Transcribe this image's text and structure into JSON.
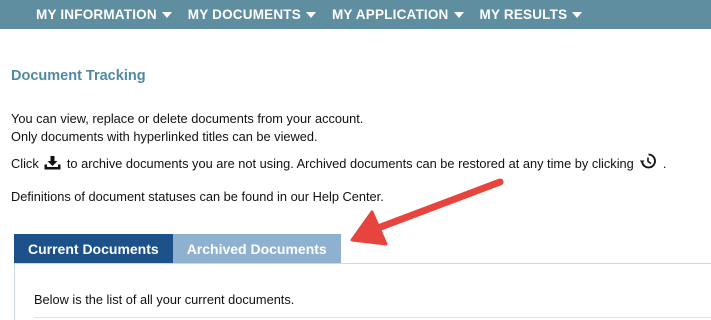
{
  "nav": {
    "items": [
      {
        "label": "MY INFORMATION"
      },
      {
        "label": "MY DOCUMENTS"
      },
      {
        "label": "MY APPLICATION"
      },
      {
        "label": "MY RESULTS"
      }
    ]
  },
  "page": {
    "title": "Document Tracking",
    "line1": "You can view, replace or delete documents from your account.",
    "line2": "Only documents with hyperlinked titles can be viewed.",
    "line3_prefix": "Click",
    "line3_middle": "to archive documents you are not using. Archived documents can be restored at any time by clicking",
    "line3_suffix": ".",
    "line4": "Definitions of document statuses can be found in our Help Center."
  },
  "tabs": {
    "current": "Current Documents",
    "archived": "Archived Documents"
  },
  "panel": {
    "text": "Below is the list of all your current documents."
  },
  "colors": {
    "nav_bg": "#5f8ea0",
    "title": "#4f8aa1",
    "tab_active": "#1c5189",
    "tab_inactive": "#8eb1cf",
    "annotation_arrow": "#e8443e"
  },
  "icons": {
    "archive": "download-tray-icon",
    "restore": "history-icon",
    "caret": "caret-down-icon"
  }
}
